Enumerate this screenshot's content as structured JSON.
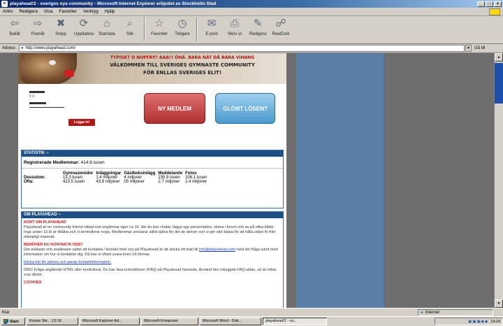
{
  "window": {
    "title": "playahead!2 - sveriges nya community - Microsoft Internet Explorer erbjudet av Stockholm Stad"
  },
  "menu": [
    "Arkiv",
    "Redigera",
    "Visa",
    "Favoriter",
    "Verktyg",
    "Hjälp"
  ],
  "toolbar": [
    {
      "label": "Bakåt",
      "glyph": "⇦",
      "icon": "back-icon"
    },
    {
      "label": "Framåt",
      "glyph": "⇨",
      "icon": "forward-icon"
    },
    {
      "label": "Stopp",
      "glyph": "✖",
      "icon": "stop-icon"
    },
    {
      "label": "Uppdatera",
      "glyph": "⟳",
      "icon": "refresh-icon"
    },
    {
      "label": "Startsida",
      "glyph": "⌂",
      "icon": "home-icon"
    },
    {
      "label": "Sök",
      "glyph": "⌕",
      "icon": "search-icon"
    },
    {
      "label": "Favoriter",
      "glyph": "☆",
      "icon": "favorites-icon"
    },
    {
      "label": "Tidigare",
      "glyph": "◷",
      "icon": "history-icon"
    },
    {
      "label": "E-post",
      "glyph": "✉",
      "icon": "mail-icon"
    },
    {
      "label": "Skriv ut",
      "glyph": "⎙",
      "icon": "print-icon"
    },
    {
      "label": "Redigera",
      "glyph": "✎",
      "icon": "edit-icon"
    },
    {
      "label": "RealCom",
      "glyph": "☍",
      "icon": "discuss-icon"
    }
  ],
  "address": {
    "label": "Adress",
    "url": "http://www.playahead.com/",
    "go": "Gå till"
  },
  "banner": {
    "line1": "TYPISKT O NOFFRY? AAA!? ÖHÄ. BARA NÄT DÅ BARA VIHANG",
    "line2": "VÄLKOMMEN TILL SVERIGES GYMNASTE COMMUNITY",
    "line3": "FÖR ENLLAS SVERIGES ELIT!"
  },
  "login": {
    "user_value": "b d",
    "submit_label": "Logga in!",
    "new_label": "NY MEDLEM",
    "forgot_label": "GLÖMT LÖSEN?"
  },
  "stats": {
    "header": "STATISTIK --",
    "registered_label": "Registrerade Medlemmar:",
    "registered_value": "414.6 tusen",
    "columns": [
      "",
      "Gymnasiesidor",
      "Inläggningar",
      "Gästboksinlägg",
      "Meddelande",
      "Fotos"
    ],
    "rows": [
      [
        "Dessutom:",
        "13.3 tusen",
        "1.4 miljoner",
        "4 miljoner",
        "235.9 tusen",
        "106.1 tusen"
      ],
      [
        "Ofta:",
        "423.5 tusen",
        "43.9 miljoner",
        "05 miljoner",
        "2.7 miljoner",
        "2.4 miljoner"
      ]
    ]
  },
  "news": {
    "header": "OM PLAYAHEAD --",
    "h1": "KORT OM PLAYAHEAD",
    "p1": "Playahead är en community främst riktad mot ungdomar äger ca 16. där du kan chatta, lägga upp presentation, skriva i forum och se på olika bilder. Inga under 13 år är tillåtna och vi kontrollerar noga. Medlemmar ansvarar alltid själva för det de skriver och vi gör vårt bästa för att hålla sidan fri från olämpligt material.",
    "h2": "BEHÖVER DU KONTAKTA OSS?",
    "p2": "Det enklaste och snabbaste sättet att kontakta / kontakt med oss på Playahead är att skicka ett mail till",
    "mail": "info@playahead.com",
    "p2b": "med din fråga samt med information om hur vi kontaktar dig. Då kan vi oftast svara inom 24 timmar.",
    "link": "Klicka här för adress och annan kontaktinformation.",
    "p3": "OBS! Fråga angående HTML eller kontrollera. Du kan läsa instruktioner (FAQ) på Playahead hemsida. Använd den inbyggda FAQ-sidan, så du hittar svar direkt.",
    "h3": "COOKIES"
  },
  "status": {
    "text": "Klar",
    "zone": "Internet"
  },
  "taskbar": {
    "start": "Start",
    "tasks": [
      "Kontor Skr... 13:1K",
      "Microsoft Explorer Ad...",
      "Microsoft Komposer",
      "Microsoft Word - Dok...",
      "playahead!2 - sv..."
    ],
    "clock": "14:24"
  },
  "colors": {
    "title_bar": "#0a246a",
    "section_header": "#1d4f82",
    "accent_red": "#b01818",
    "right_column": "#5b7fa6"
  }
}
